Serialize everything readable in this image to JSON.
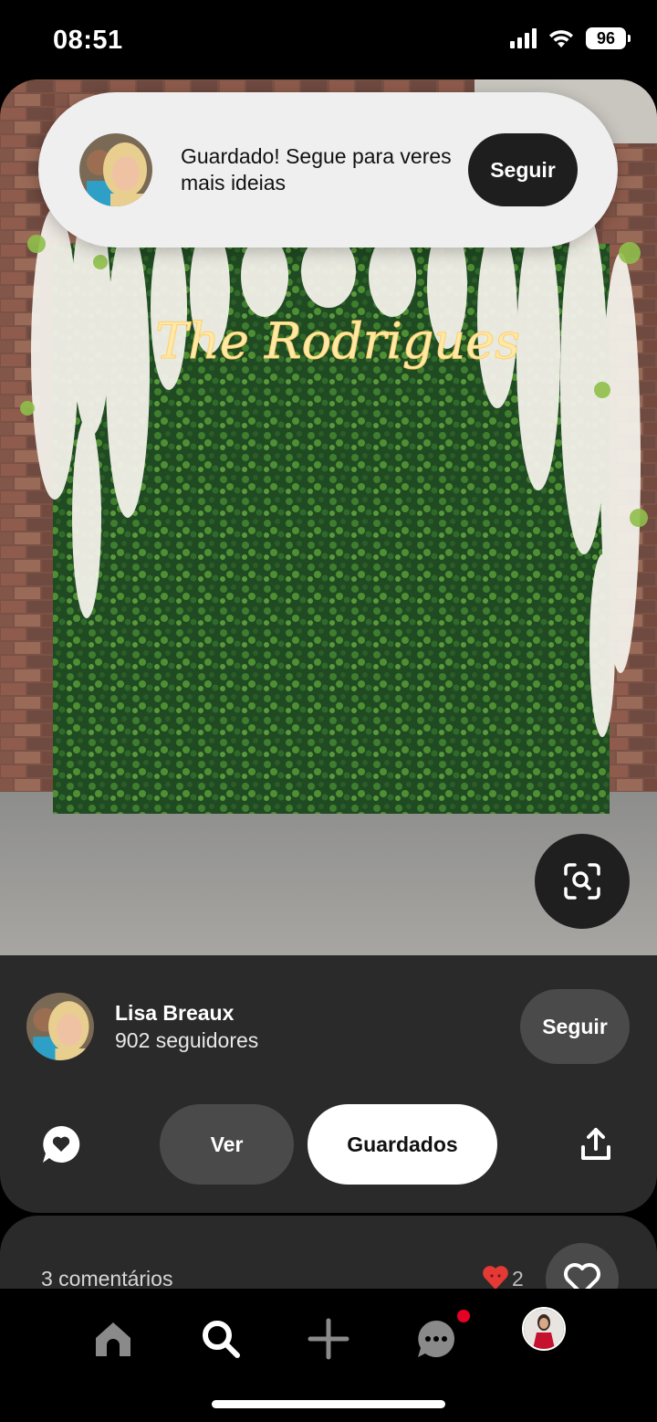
{
  "status_bar": {
    "time": "08:51",
    "battery": "96"
  },
  "toast": {
    "message": "Guardado! Segue para veres mais ideias",
    "follow_label": "Seguir"
  },
  "pin": {
    "neon_sign": "The Rodrigues"
  },
  "creator": {
    "name": "Lisa Breaux",
    "followers": "902 seguidores",
    "follow_label": "Seguir"
  },
  "actions": {
    "view_label": "Ver",
    "saved_label": "Guardados"
  },
  "comments": {
    "count_label": "3 comentários",
    "reaction_count": "2"
  },
  "tab_bar": {
    "items": [
      "home",
      "search",
      "create",
      "messages",
      "profile"
    ]
  },
  "colors": {
    "accent_red": "#e60023",
    "panel": "#2a2a2a",
    "button_gray": "#4a4a4a"
  }
}
